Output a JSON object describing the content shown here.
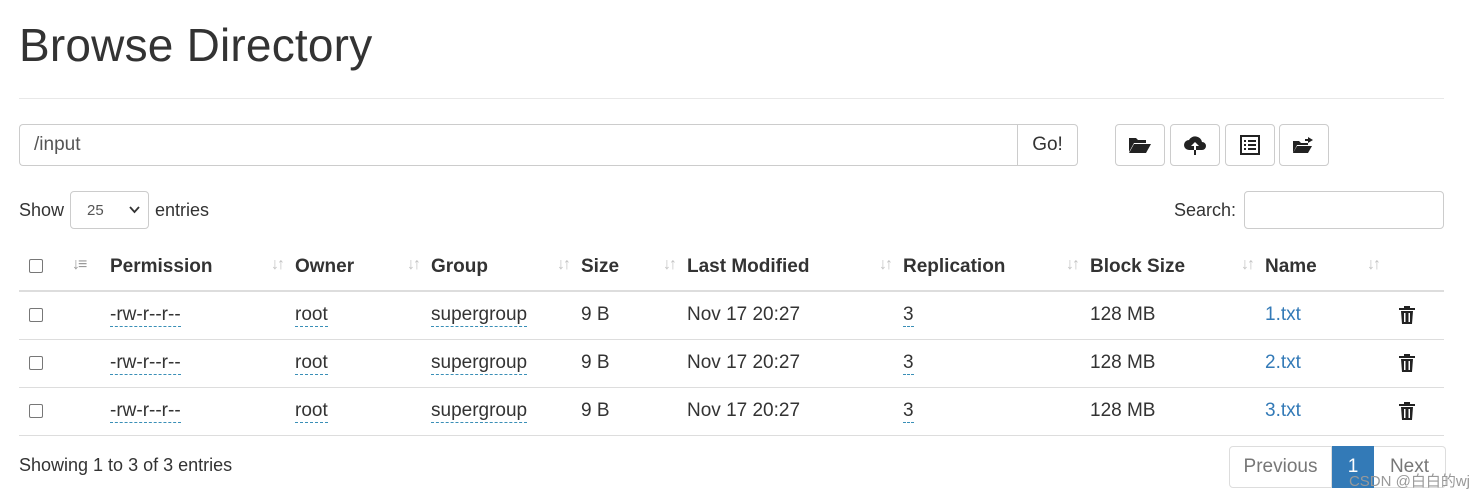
{
  "page": {
    "title": "Browse Directory"
  },
  "path_bar": {
    "value": "/input",
    "go_label": "Go!"
  },
  "toolbar": {
    "buttons": [
      {
        "icon": "folder-open-icon"
      },
      {
        "icon": "cloud-upload-icon"
      },
      {
        "icon": "list-alt-icon"
      },
      {
        "icon": "folder-share-icon"
      }
    ]
  },
  "length_menu": {
    "prefix": "Show",
    "value": "25",
    "suffix": "entries"
  },
  "search": {
    "label": "Search:",
    "value": ""
  },
  "table": {
    "columns": [
      "Permission",
      "Owner",
      "Group",
      "Size",
      "Last Modified",
      "Replication",
      "Block Size",
      "Name"
    ],
    "rows": [
      {
        "permission": "-rw-r--r--",
        "owner": "root",
        "group": "supergroup",
        "size": "9 B",
        "modified": "Nov 17 20:27",
        "replication": "3",
        "block_size": "128 MB",
        "name": "1.txt"
      },
      {
        "permission": "-rw-r--r--",
        "owner": "root",
        "group": "supergroup",
        "size": "9 B",
        "modified": "Nov 17 20:27",
        "replication": "3",
        "block_size": "128 MB",
        "name": "2.txt"
      },
      {
        "permission": "-rw-r--r--",
        "owner": "root",
        "group": "supergroup",
        "size": "9 B",
        "modified": "Nov 17 20:27",
        "replication": "3",
        "block_size": "128 MB",
        "name": "3.txt"
      }
    ]
  },
  "footer": {
    "info": "Showing 1 to 3 of 3 entries",
    "pagination": {
      "previous": "Previous",
      "current": "1",
      "next": "Next"
    }
  },
  "watermark": "CSDN @白白的wj",
  "colors": {
    "link": "#337ab7",
    "active_page": "#337ab7",
    "border": "#dddddd"
  }
}
